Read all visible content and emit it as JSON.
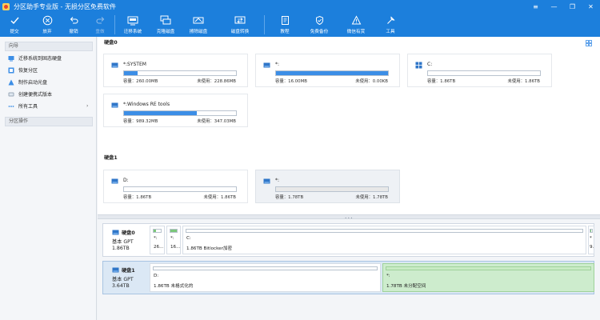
{
  "window": {
    "title": "分区助手专业版 - 无损分区免费软件",
    "controls": [
      "≡",
      "—",
      "❐",
      "✕"
    ]
  },
  "toolbar": {
    "buttons": [
      {
        "label": "提交",
        "icon": "check-icon",
        "enabled": true
      },
      {
        "label": "放弃",
        "icon": "cancel-circle-icon",
        "enabled": true
      },
      {
        "label": "撤销",
        "icon": "undo-icon",
        "enabled": true
      },
      {
        "label": "重做",
        "icon": "redo-icon",
        "enabled": false
      },
      {
        "label": "迁移系统",
        "icon": "migrate-os-icon",
        "enabled": true
      },
      {
        "label": "克隆磁盘",
        "icon": "clone-disk-icon",
        "enabled": true
      },
      {
        "label": "擦除磁盘",
        "icon": "wipe-disk-icon",
        "enabled": true
      },
      {
        "label": "磁盘转换",
        "icon": "convert-disk-icon",
        "enabled": true
      },
      {
        "label": "教程",
        "icon": "tutorial-icon",
        "enabled": true
      },
      {
        "label": "免费备份",
        "icon": "backup-icon",
        "enabled": true
      },
      {
        "label": "微信有赏",
        "icon": "reward-icon",
        "enabled": true
      },
      {
        "label": "工具",
        "icon": "tools-icon",
        "enabled": true
      }
    ]
  },
  "sidebar": {
    "wizard_title": "向导",
    "items": [
      {
        "label": "迁移系统到固态硬盘",
        "icon": "migrate-icon"
      },
      {
        "label": "恢复分区",
        "icon": "recover-partition-icon"
      },
      {
        "label": "制作启动光盘",
        "icon": "boot-disc-icon"
      },
      {
        "label": "创建便携式版本",
        "icon": "portable-version-icon"
      },
      {
        "label": "所有工具",
        "icon": "all-tools-icon",
        "arrow": "›"
      }
    ],
    "ops_title": "分区操作"
  },
  "disk_view": {
    "disks": [
      {
        "label": "硬盘0",
        "partitions": [
          {
            "name": "*:SYSTEM",
            "capacity": "容量：260.00MB",
            "free": "未使用：228.86MB",
            "used_fraction": 0.12,
            "icon": "partition-drive-icon"
          },
          {
            "name": "*:",
            "capacity": "容量：16.00MB",
            "free": "未使用：0.00KB",
            "used_fraction": 1.0,
            "icon": "partition-drive-icon"
          },
          {
            "name": "C:",
            "capacity": "容量：1.86TB",
            "free": "未使用：1.86TB",
            "used_fraction": 0.0,
            "icon": "windows-logo-icon"
          },
          {
            "name": "*:Windows RE tools",
            "capacity": "容量：989.32MB",
            "free": "未使用：347.03MB",
            "used_fraction": 0.65,
            "icon": "partition-drive-icon"
          }
        ]
      },
      {
        "label": "硬盘1",
        "partitions": [
          {
            "name": "D:",
            "capacity": "容量：1.86TB",
            "free": "未使用：1.86TB",
            "used_fraction": 0.0,
            "icon": "partition-drive-icon"
          },
          {
            "name": "*:",
            "capacity": "容量：1.78TB",
            "free": "未使用：1.78TB",
            "used_fraction": 0.0,
            "icon": "partition-drive-icon"
          }
        ]
      }
    ]
  },
  "disk_map": [
    {
      "name": "硬盘0",
      "type": "基本 GPT",
      "size": "1.86TB",
      "partitions": [
        {
          "top": "*:",
          "bottom": "26...",
          "used_fraction": 0.3
        },
        {
          "top": "*:",
          "bottom": "16...",
          "used_fraction": 1.0
        },
        {
          "top": "C:",
          "bottom": "1.86TB Bitlocker加密",
          "used_fraction": 0.0
        },
        {
          "top": "*",
          "bottom": "9.",
          "used_fraction": 0.6
        }
      ]
    },
    {
      "name": "硬盘1",
      "type": "基本 GPT",
      "size": "3.64TB",
      "partitions": [
        {
          "top": "D:",
          "bottom": "1.86TB 未格式化的",
          "used_fraction": 0.0
        },
        {
          "top": "*:",
          "bottom": "1.78TB 未分配空间",
          "used_fraction": 0.0
        }
      ]
    }
  ],
  "colors": {
    "titlebar": "#1c7fdc",
    "usage_bar": "#3c8ee6",
    "map_usage": "#7bc77a",
    "unallocated": "#cdeccd"
  }
}
